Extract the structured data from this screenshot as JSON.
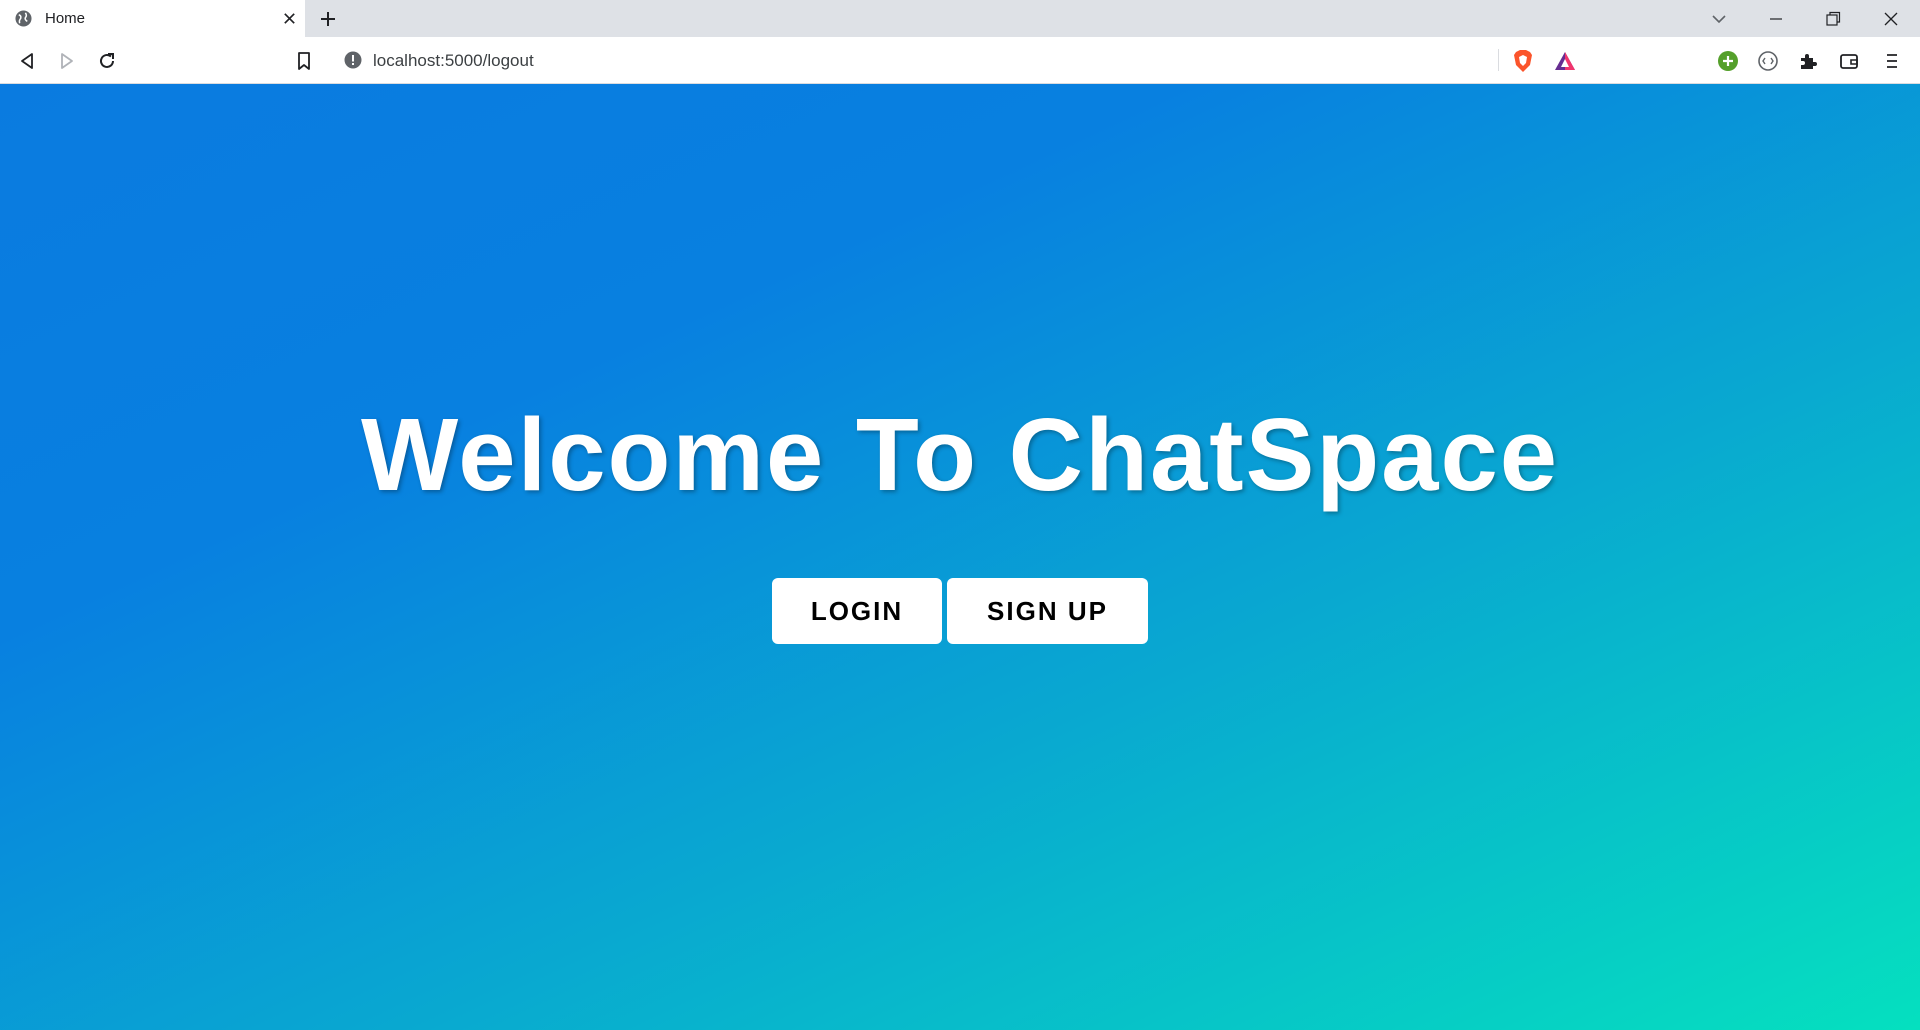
{
  "browser": {
    "tab": {
      "title": "Home",
      "icon": "globe-icon"
    },
    "address_bar": {
      "url": "localhost:5000/logout"
    },
    "toolbar_icons": [
      "back-icon",
      "forward-icon",
      "reload-icon",
      "bookmark-icon",
      "site-info-icon",
      "brave-shields-icon",
      "brave-rewards-icon",
      "add-extension-icon",
      "vpn-icon",
      "extensions-icon",
      "wallet-icon",
      "menu-icon"
    ]
  },
  "page": {
    "heading": "Welcome To ChatSpace",
    "login_label": "LOGIN",
    "signup_label": "SIGN UP"
  },
  "colors": {
    "gradient_start": "#0a7be0",
    "gradient_end": "#05e0bf",
    "brave_orange": "#fb542b",
    "rewards_purple": "#662d91",
    "vpn_green": "#55a02b"
  }
}
